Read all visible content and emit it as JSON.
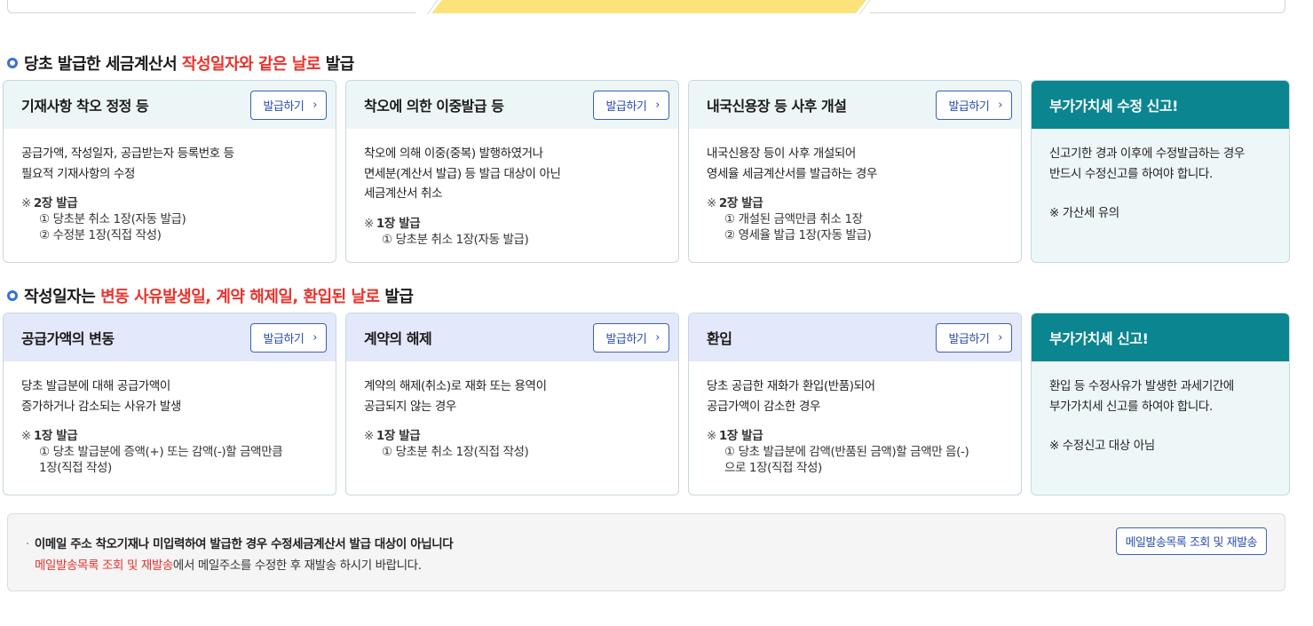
{
  "colors": {
    "accent_red": "#e8332c",
    "accent_blue": "#3b6fd6",
    "teal": "#0b8590",
    "highlight_yellow": "#fbe27a"
  },
  "section1": {
    "title_pre": "당초 발급한 세금계산서 ",
    "title_red": "작성일자와 같은 날로",
    "title_post": " 발급",
    "cards": [
      {
        "title": "기재사항 착오 정정 등",
        "button": "발급하기",
        "desc": "공급가액, 작성일자, 공급받는자 등록번호 등\n필요적 기재사항의 수정",
        "note_head": "2장 발급",
        "note_items": [
          "① 당초분 취소 1장(자동 발급)",
          "② 수정분 1장(직접 작성)"
        ]
      },
      {
        "title": "착오에 의한 이중발급 등",
        "button": "발급하기",
        "desc": "착오에 의해 이중(중복) 발행하였거나\n면세분(계산서 발급) 등 발급 대상이 아닌\n세금계산서 취소",
        "note_head": "1장 발급",
        "note_items": [
          "① 당초분 취소 1장(자동 발급)"
        ]
      },
      {
        "title": "내국신용장 등 사후 개설",
        "button": "발급하기",
        "desc": "내국신용장 등이 사후 개설되어\n영세율 세금계산서를 발급하는 경우",
        "note_head": "2장 발급",
        "note_items": [
          "① 개설된 금액만큼 취소 1장",
          "② 영세율 발급 1장(자동 발급)"
        ]
      },
      {
        "title": "부가가치세 수정 신고!",
        "desc": "신고기한 경과 이후에 수정발급하는 경우\n반드시 수정신고를 하여야 합니다.",
        "note": "※ 가산세 유의"
      }
    ]
  },
  "section2": {
    "title_pre": "작성일자는 ",
    "title_red": "변동 사유발생일, 계약 해제일, 환입된 날로",
    "title_post": " 발급",
    "cards": [
      {
        "title": "공급가액의 변동",
        "button": "발급하기",
        "desc": "당초 발급분에 대해 공급가액이\n증가하거나 감소되는 사유가 발생",
        "note_head": "1장 발급",
        "note_items": [
          "① 당초 발급분에 증액(+) 또는 감액(-)할 금액만큼",
          "1장(직접 작성)"
        ]
      },
      {
        "title": "계약의 해제",
        "button": "발급하기",
        "desc": "계약의 해제(취소)로 재화 또는 용역이\n공급되지 않는 경우",
        "note_head": "1장 발급",
        "note_items": [
          "① 당초분 취소 1장(직접 작성)"
        ]
      },
      {
        "title": "환입",
        "button": "발급하기",
        "desc": "당초 공급한 재화가 환입(반품)되어\n공급가액이 감소한 경우",
        "note_head": "1장 발급",
        "note_items": [
          "① 당초 발급분에 감액(반품된 금액)할 금액만 음(-)",
          "으로 1장(직접 작성)"
        ]
      },
      {
        "title": "부가가치세 신고!",
        "desc": "환입 등 수정사유가 발생한 과세기간에\n부가가치세 신고를 하여야 합니다.",
        "note": "※ 수정신고 대상 아님"
      }
    ]
  },
  "notice": {
    "line1": "이메일 주소 착오기재나 미입력하여 발급한 경우 수정세금계산서 발급 대상이 아닙니다",
    "line2_red": "메일발송목록 조회 및 재발송",
    "line2_rest": "에서 메일주소를 수정한 후 재발송 하시기 바랍니다.",
    "button": "메일발송목록 조회 및 재발송"
  },
  "note_mark": "※"
}
